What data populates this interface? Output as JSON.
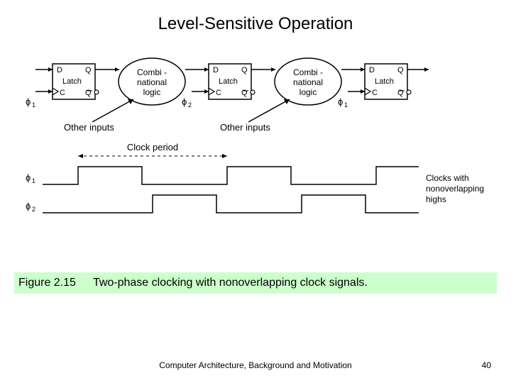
{
  "title": "Level-Sensitive Operation",
  "diagram": {
    "latch": {
      "D": "D",
      "Q": "Q",
      "C": "C",
      "Qbar": "Q",
      "name": "Latch"
    },
    "combi": {
      "line1": "Combi -",
      "line2": "national",
      "line3": "logic"
    },
    "phi1": "ϕ",
    "phi1_sub": "1",
    "phi2": "ϕ",
    "phi2_sub": "2",
    "other_inputs": "Other inputs",
    "clock_period": "Clock period",
    "clocks_note_l1": "Clocks with",
    "clocks_note_l2": "nonoverlapping",
    "clocks_note_l3": "highs"
  },
  "caption": {
    "figure": "Figure 2.15",
    "text": "Two-phase clocking with nonoverlapping clock signals."
  },
  "footer": "Computer Architecture, Background and Motivation",
  "page": "40"
}
